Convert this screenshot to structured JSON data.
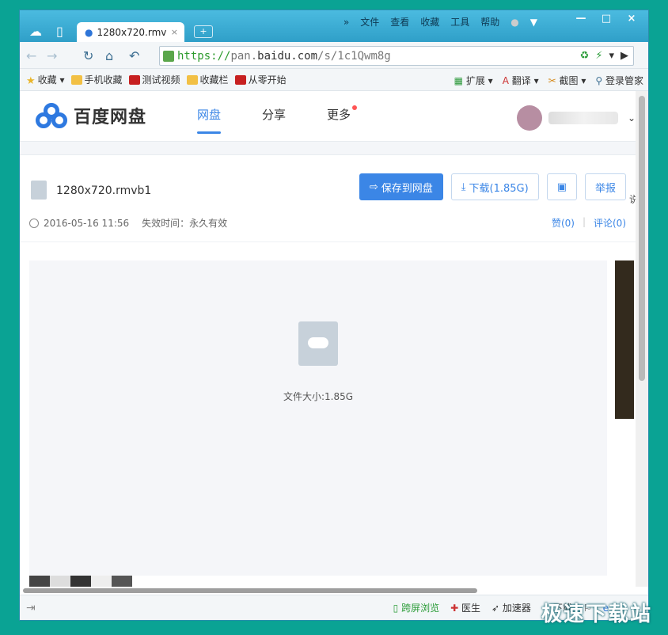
{
  "browser": {
    "tab_title": "1280x720.rmv",
    "tab_close": "×",
    "new_tab": "+",
    "menu_more": "»",
    "menu": [
      "文件",
      "查看",
      "收藏",
      "工具",
      "帮助"
    ],
    "window_controls": [
      "—",
      "□",
      "×"
    ],
    "url_scheme": "https://",
    "url_host_prefix": "pan.",
    "url_host_main": "baidu.com",
    "url_path": "/s/1c1Qwm8g",
    "bookmarks": [
      {
        "label": "收藏",
        "icon": "star-icon"
      },
      {
        "label": "手机收藏",
        "icon": "folder-icon"
      },
      {
        "label": "测试视频",
        "icon": "c-icon"
      },
      {
        "label": "收藏栏",
        "icon": "folder-icon"
      },
      {
        "label": "从零开始",
        "icon": "c-icon"
      }
    ],
    "bookmarks_right": [
      "扩展",
      "翻译",
      "截图",
      "登录管家"
    ],
    "status_items": [
      "跨屏浏览",
      "医生",
      "加速器",
      "下载"
    ]
  },
  "page": {
    "brand": "百度网盘",
    "nav": [
      "网盘",
      "分享",
      "更多"
    ],
    "file_name": "1280x720.rmvb1",
    "buttons": {
      "save": "保存到网盘",
      "download": "下载(1.85G)",
      "report": "举报"
    },
    "share_date": "2016-05-16 11:56",
    "expire": "失效时间：永久有效",
    "like": "赞(0)",
    "comment": "评论(0)",
    "file_size": "文件大小:1.85G",
    "side_text": "说"
  },
  "watermark": "极速下载站",
  "colors": {
    "accent": "#3b86e6",
    "desktop": "#0aa394",
    "titlebar": "#3aa9c8"
  }
}
